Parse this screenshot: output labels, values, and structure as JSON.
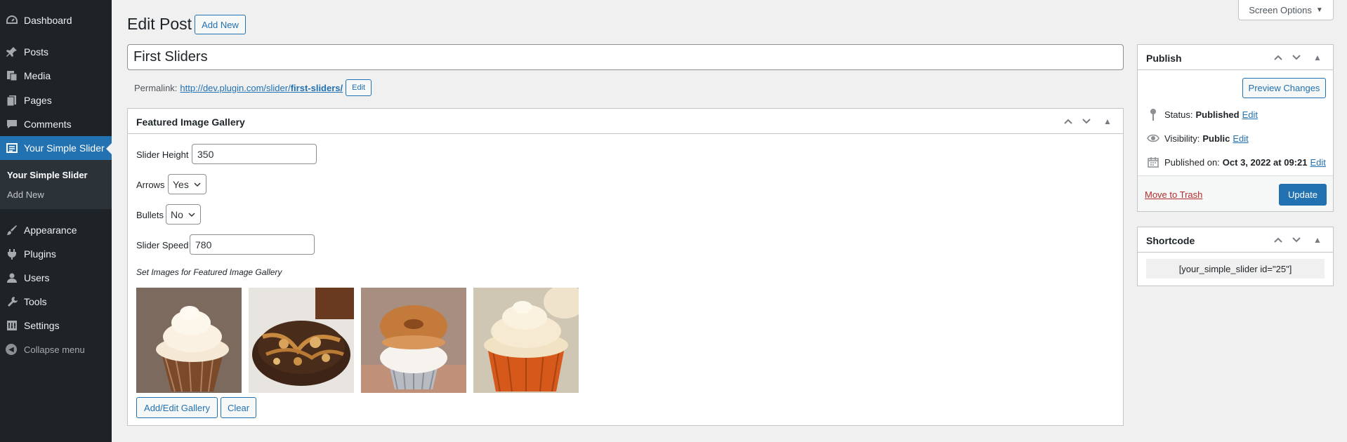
{
  "sidebar": {
    "items": [
      {
        "label": "Dashboard",
        "icon": "dashboard-icon"
      },
      {
        "label": "Posts",
        "icon": "pushpin-icon"
      },
      {
        "label": "Media",
        "icon": "media-icon"
      },
      {
        "label": "Pages",
        "icon": "pages-icon"
      },
      {
        "label": "Comments",
        "icon": "comments-icon"
      },
      {
        "label": "Your Simple Slider",
        "icon": "slider-icon"
      },
      {
        "label": "Appearance",
        "icon": "brush-icon"
      },
      {
        "label": "Plugins",
        "icon": "plugins-icon"
      },
      {
        "label": "Users",
        "icon": "users-icon"
      },
      {
        "label": "Tools",
        "icon": "wrench-icon"
      },
      {
        "label": "Settings",
        "icon": "settings-icon"
      }
    ],
    "submenu": [
      "Your Simple Slider",
      "Add New"
    ],
    "collapse_label": "Collapse menu"
  },
  "header": {
    "title": "Edit Post",
    "add_new_label": "Add New",
    "screen_options_label": "Screen Options"
  },
  "post": {
    "title": "First Sliders",
    "permalink_label": "Permalink:",
    "permalink_base": "http://dev.plugin.com/slider/",
    "permalink_slug": "first-sliders/",
    "permalink_edit_label": "Edit"
  },
  "gallery_box": {
    "title": "Featured Image Gallery",
    "slider_height_label": "Slider Height",
    "slider_height_value": "350",
    "arrows_label": "Arrows",
    "arrows_value": "Yes",
    "bullets_label": "Bullets",
    "bullets_value": "No",
    "slider_speed_label": "Slider Speed",
    "slider_speed_value": "780",
    "images_caption": "Set Images for Featured Image Gallery",
    "images": [
      "cupcake-frosted-1",
      "brownie-cookie",
      "donut-cupcake",
      "cupcake-frosted-2"
    ],
    "add_edit_label": "Add/Edit Gallery",
    "clear_label": "Clear"
  },
  "publish_box": {
    "title": "Publish",
    "preview_label": "Preview Changes",
    "status_label": "Status:",
    "status_value": "Published",
    "status_edit": "Edit",
    "visibility_label": "Visibility:",
    "visibility_value": "Public",
    "visibility_edit": "Edit",
    "published_label": "Published on:",
    "published_value": "Oct 3, 2022 at 09:21",
    "published_edit": "Edit",
    "trash_label": "Move to Trash",
    "update_label": "Update"
  },
  "shortcode_box": {
    "title": "Shortcode",
    "value": "[your_simple_slider id=\"25\"]"
  },
  "colors": {
    "sidebar_bg": "#1d2327",
    "accent": "#2271b1",
    "page_bg": "#f0f0f1"
  }
}
